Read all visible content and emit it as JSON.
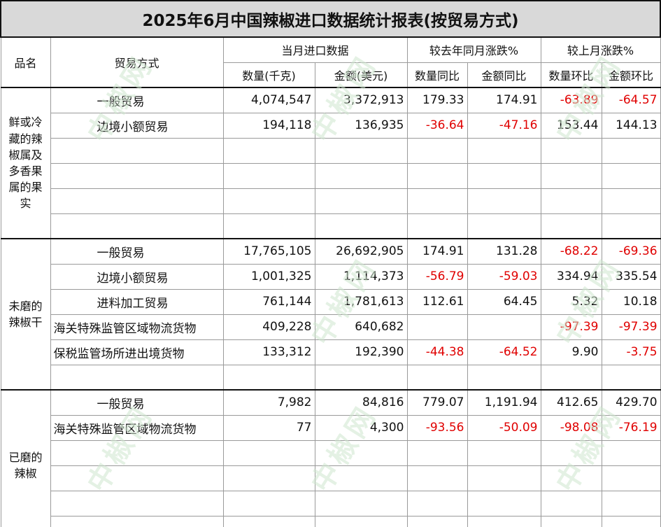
{
  "title": "2025年6月中国辣椒进口数据统计报表(按贸易方式)",
  "headers": {
    "product": "品名",
    "trade_mode": "贸易方式",
    "current_month": "当月进口数据",
    "yoy": "较去年同月涨跌%",
    "mom": "较上月涨跌%",
    "qty": "数量(千克)",
    "amt": "金额(美元)",
    "qty_yoy": "数量同比",
    "amt_yoy": "金额同比",
    "qty_mom": "数量环比",
    "amt_mom": "金额环比"
  },
  "groups": [
    {
      "category": "鲜或冷藏的辣椒属及多香果属的果实",
      "rows": [
        {
          "trade": "一般贸易",
          "qty": "4,074,547",
          "amt": "3,372,913",
          "qty_yoy": "179.33",
          "amt_yoy": "174.91",
          "qty_mom": "-63.89",
          "amt_mom": "-64.57"
        },
        {
          "trade": "边境小额贸易",
          "qty": "194,118",
          "amt": "136,935",
          "qty_yoy": "-36.64",
          "amt_yoy": "-47.16",
          "qty_mom": "153.44",
          "amt_mom": "144.13"
        }
      ],
      "blank_rows": 4
    },
    {
      "category": "未磨的辣椒干",
      "rows": [
        {
          "trade": "一般贸易",
          "qty": "17,765,105",
          "amt": "26,692,905",
          "qty_yoy": "174.91",
          "amt_yoy": "131.28",
          "qty_mom": "-68.22",
          "amt_mom": "-69.36"
        },
        {
          "trade": "边境小额贸易",
          "qty": "1,001,325",
          "amt": "1,114,373",
          "qty_yoy": "-56.79",
          "amt_yoy": "-59.03",
          "qty_mom": "334.94",
          "amt_mom": "335.54"
        },
        {
          "trade": "进料加工贸易",
          "qty": "761,144",
          "amt": "1,781,613",
          "qty_yoy": "112.61",
          "amt_yoy": "64.45",
          "qty_mom": "5.32",
          "amt_mom": "10.18"
        },
        {
          "trade": "海关特殊监管区域物流货物",
          "qty": "409,228",
          "amt": "640,682",
          "qty_yoy": "",
          "amt_yoy": "",
          "qty_mom": "-97.39",
          "amt_mom": "-97.39"
        },
        {
          "trade": "保税监管场所进出境货物",
          "qty": "133,312",
          "amt": "192,390",
          "qty_yoy": "-44.38",
          "amt_yoy": "-64.52",
          "qty_mom": "9.90",
          "amt_mom": "-3.75"
        }
      ],
      "blank_rows": 1
    },
    {
      "category": "已磨的辣椒",
      "rows": [
        {
          "trade": "一般贸易",
          "qty": "7,982",
          "amt": "84,816",
          "qty_yoy": "779.07",
          "amt_yoy": "1,191.94",
          "qty_mom": "412.65",
          "amt_mom": "429.70"
        },
        {
          "trade": "海关特殊监管区域物流货物",
          "qty": "77",
          "amt": "4,300",
          "qty_yoy": "-93.56",
          "amt_yoy": "-50.09",
          "qty_mom": "-98.08",
          "amt_mom": "-76.19"
        }
      ],
      "blank_rows": 4
    }
  ],
  "colors": {
    "negative": "#e00000",
    "title_bg": "#d9d9d9"
  }
}
